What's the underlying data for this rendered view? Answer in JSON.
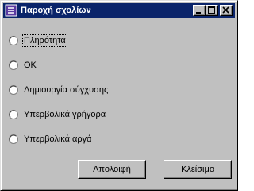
{
  "window": {
    "title": "Παροχή σχολίων",
    "icon": "feedback-app-icon",
    "accent_color": "#0a246a",
    "face_color": "#c0c0c0"
  },
  "options": [
    {
      "label": "Πληρότητα",
      "selected": false,
      "focused": true
    },
    {
      "label": "OK",
      "selected": false,
      "focused": false
    },
    {
      "label": "Δημιουργία σύγχυσης",
      "selected": false,
      "focused": false
    },
    {
      "label": "Υπερβολικά γρήγορα",
      "selected": false,
      "focused": false
    },
    {
      "label": "Υπερβολικά αργά",
      "selected": false,
      "focused": false
    }
  ],
  "buttons": {
    "cancel_label": "Απολοιφή",
    "close_label": "Κλείσιμο"
  }
}
